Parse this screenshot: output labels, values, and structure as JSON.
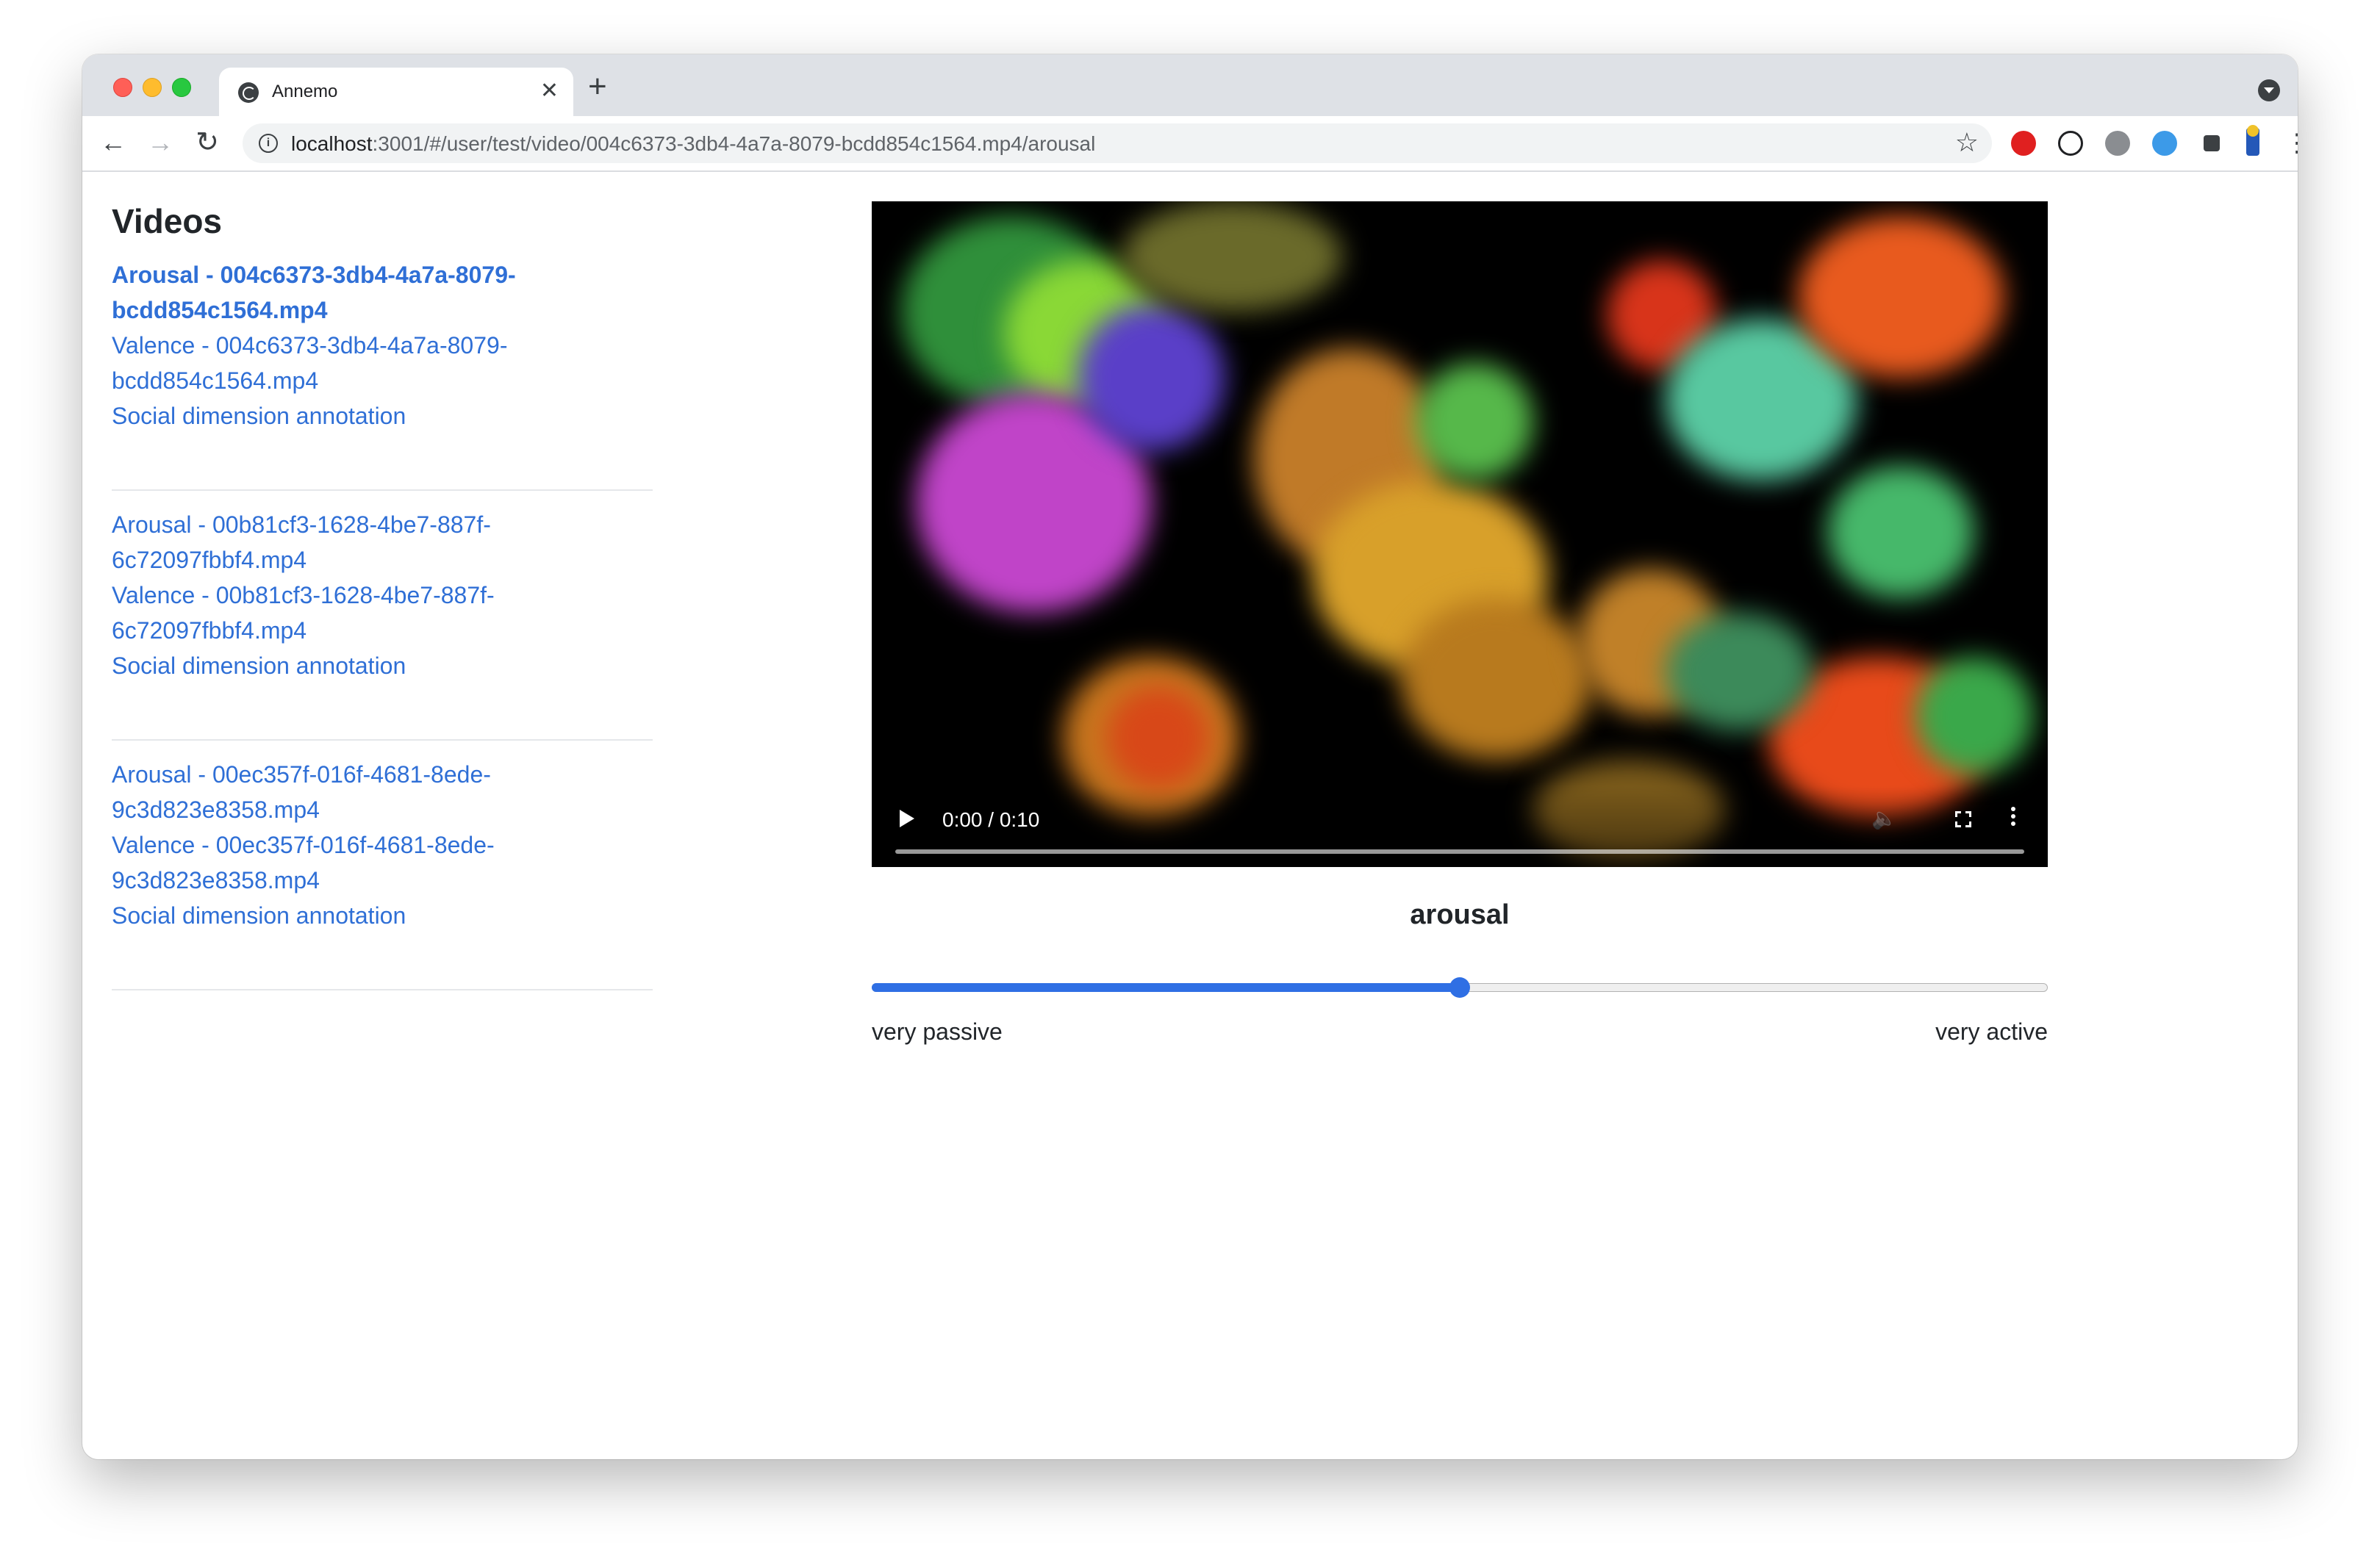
{
  "browser": {
    "tab_title": "Annemo",
    "new_tab": "+",
    "tab_close": "✕",
    "url_host": "localhost",
    "url_rest": ":3001/#/user/test/video/004c6373-3db4-4a7a-8079-bcdd854c1564.mp4/arousal",
    "nav": {
      "back": "←",
      "forward": "→",
      "reload": "↻"
    },
    "star": "☆",
    "menu": "⋮",
    "info": "i",
    "extensions": [
      "adblock-icon",
      "password-manager-icon",
      "settings-extension-icon",
      "tool-extension-icon",
      "extensions-puzzle-icon",
      "reading-extension-icon"
    ]
  },
  "sidebar": {
    "title": "Videos",
    "groups": [
      {
        "arousal": "Arousal - 004c6373-3db4-4a7a-8079-bcdd854c1564.mp4",
        "valence": "Valence - 004c6373-3db4-4a7a-8079-bcdd854c1564.mp4",
        "social": "Social dimension annotation",
        "active": "arousal"
      },
      {
        "arousal": "Arousal - 00b81cf3-1628-4be7-887f-6c72097fbbf4.mp4",
        "valence": "Valence - 00b81cf3-1628-4be7-887f-6c72097fbbf4.mp4",
        "social": "Social dimension annotation"
      },
      {
        "arousal": "Arousal - 00ec357f-016f-4681-8ede-9c3d823e8358.mp4",
        "valence": "Valence - 00ec357f-016f-4681-8ede-9c3d823e8358.mp4",
        "social": "Social dimension annotation"
      }
    ]
  },
  "player": {
    "time": "0:00 / 0:10",
    "progress": 0
  },
  "annotation": {
    "dimension": "arousal",
    "slider_value": 0.5,
    "min_label": "very passive",
    "max_label": "very active",
    "accent_color": "#2f6fe4"
  },
  "colors": {
    "link": "#2f6fd6",
    "text": "#212529"
  }
}
